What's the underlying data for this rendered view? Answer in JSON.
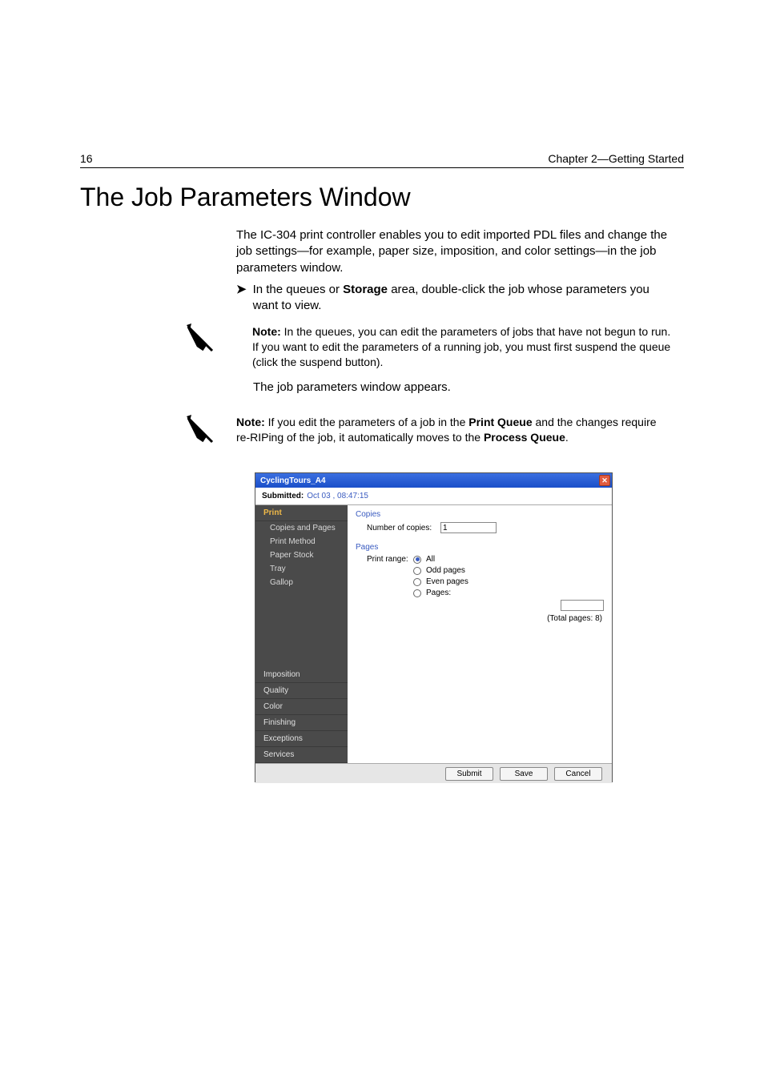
{
  "page_number": "16",
  "chapter_header": "Chapter 2—Getting Started",
  "heading": "The Job Parameters Window",
  "para1": "The IC-304 print controller enables you to edit imported PDL files and change the job settings—for example, paper size, imposition, and color settings—in the job parameters window.",
  "bullet_prefix": "In the queues or ",
  "bullet_bold": "Storage",
  "bullet_suffix": " area, double-click the job whose parameters you want to view.",
  "note1_label": "Note:",
  "note1_text": "  In the queues, you can edit the parameters of jobs that have not begun to run. If you want to edit the parameters of a running job, you must first suspend the queue (click the suspend button).",
  "para2": "The job parameters window appears.",
  "note2_label": "Note:",
  "note2_a": "  If you edit the parameters of a job in the ",
  "note2_b": "Print Queue",
  "note2_c": " and the changes require re-RIPing of the job, it automatically moves to the ",
  "note2_d": "Process Queue",
  "note2_e": ".",
  "window": {
    "title": "CyclingTours_A4",
    "submitted_label": "Submitted:",
    "submitted_value": "Oct 03 , 08:47:15",
    "sidebar_active": "Print",
    "sidebar_active_items": [
      "Copies and Pages",
      "Print Method",
      "Paper Stock",
      "Tray",
      "Gallop"
    ],
    "sidebar_sections": [
      "Imposition",
      "Quality",
      "Color",
      "Finishing",
      "Exceptions",
      "Services"
    ],
    "copies_heading": "Copies",
    "copies_label": "Number of copies:",
    "copies_value": "1",
    "pages_heading": "Pages",
    "print_range_label": "Print range:",
    "range_all": "All",
    "range_odd": "Odd pages",
    "range_even": "Even pages",
    "range_pages": "Pages:",
    "total_pages": "(Total pages: 8)",
    "btn_submit": "Submit",
    "btn_save": "Save",
    "btn_cancel": "Cancel"
  }
}
